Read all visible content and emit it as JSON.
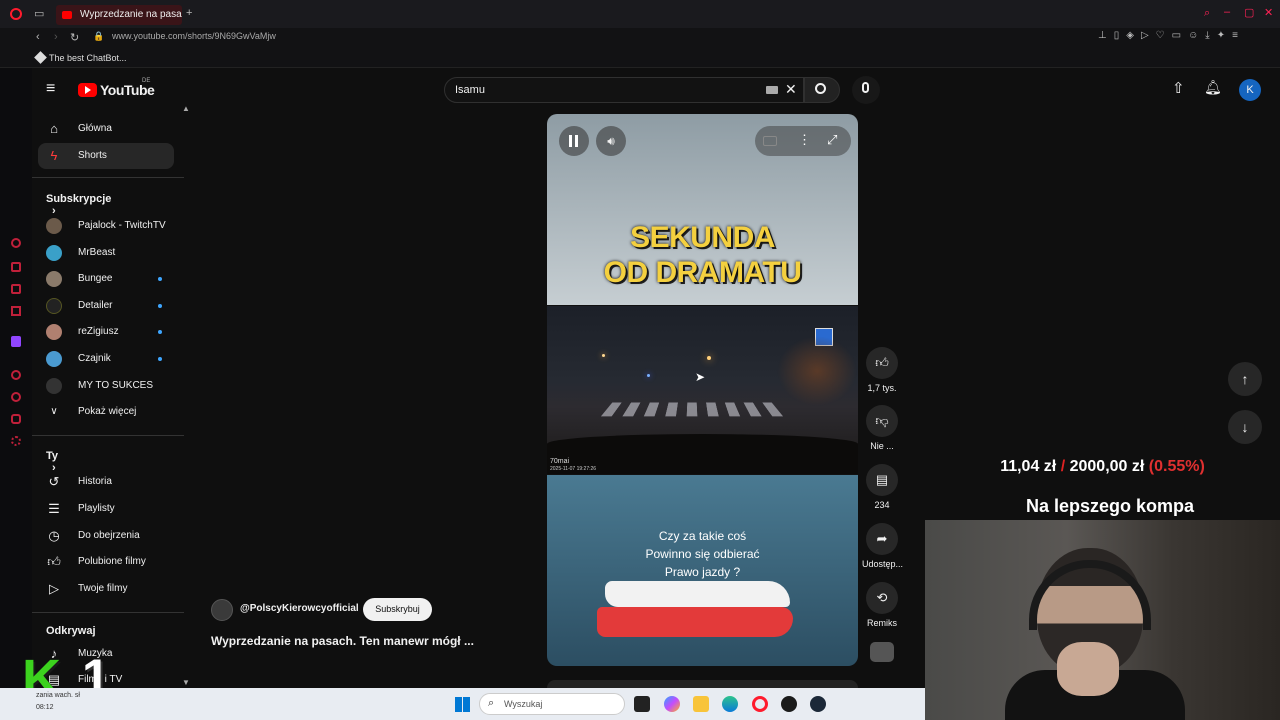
{
  "browser": {
    "tab_title": "Wyprzedzanie na pasa",
    "url": "www.youtube.com/shorts/9N69GwVaMjw",
    "bookmark": "The best ChatBot..."
  },
  "youtube": {
    "logo_text": "YouTube",
    "logo_region": "DE",
    "search_value": "Isamu",
    "user_initial": "K",
    "nav": [
      {
        "label": "Główna",
        "icon": "home-icon"
      },
      {
        "label": "Shorts",
        "icon": "shorts-icon"
      }
    ],
    "subscriptions_title": "Subskrypcje",
    "subscriptions": [
      {
        "label": "Pajalock - TwitchTV",
        "color": "#6b5a4a",
        "dot": false
      },
      {
        "label": "MrBeast",
        "color": "#3aa0c8",
        "dot": false
      },
      {
        "label": "Bungee",
        "color": "#8a7a6a",
        "dot": true
      },
      {
        "label": "Detailer",
        "color": "#222222",
        "dot": true
      },
      {
        "label": "reZigiusz",
        "color": "#b08070",
        "dot": true
      },
      {
        "label": "Czajnik",
        "color": "#4a9ad0",
        "dot": true
      },
      {
        "label": "MY TO SUKCES",
        "color": "#333333",
        "dot": false
      }
    ],
    "show_more": "Pokaż więcej",
    "you_title": "Ty",
    "you_items": [
      {
        "label": "Historia",
        "icon": "history-icon"
      },
      {
        "label": "Playlisty",
        "icon": "playlist-icon"
      },
      {
        "label": "Do obejrzenia",
        "icon": "clock-icon"
      },
      {
        "label": "Polubione filmy",
        "icon": "thumb-up-icon"
      },
      {
        "label": "Twoje filmy",
        "icon": "play-icon"
      }
    ],
    "discover_title": "Odkrywaj",
    "discover_items": [
      {
        "label": "Muzyka"
      },
      {
        "label": "Filmy i TV"
      }
    ]
  },
  "short": {
    "title_line1": "SEKUNDA",
    "title_line2": "OD DRAMATU",
    "dashcam_stamp": "70mai",
    "dashcam_time": "2025-11-07 19:27:26",
    "question_line1": "Czy za takie coś",
    "question_line2": "Powinno się odbierać",
    "question_line3": "Prawo jazdy ?",
    "channel": "@PolscyKierowcyofficial",
    "subscribe": "Subskrybuj",
    "video_title": "Wyprzedzanie na pasach. Ten manewr mógł ..."
  },
  "actions": [
    {
      "icon": "thumb-up-icon",
      "label": "1,7 tys."
    },
    {
      "icon": "thumb-down-icon",
      "label": "Nie ..."
    },
    {
      "icon": "comment-icon",
      "label": "234"
    },
    {
      "icon": "share-icon",
      "label": "Udostęp..."
    },
    {
      "icon": "remix-icon",
      "label": "Remiks"
    }
  ],
  "overlay": {
    "donation_current": "11,04 zł",
    "donation_separator": "/",
    "donation_goal": "2000,00 zł",
    "donation_percent": "(0.55%)",
    "donation_caption": "Na lepszego kompa",
    "brand_number": "1"
  },
  "taskbar": {
    "search_placeholder": "Wyszukaj",
    "weather_text": "zania wach. sł",
    "time": "08:12"
  }
}
